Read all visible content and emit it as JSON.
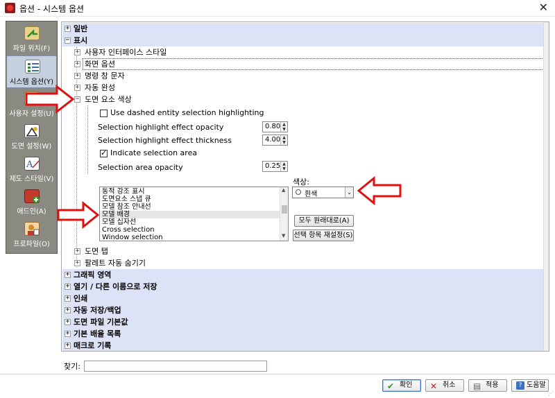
{
  "window": {
    "title": "옵션 - 시스템 옵션",
    "close_icon": "close-icon"
  },
  "sidebar": {
    "items": [
      {
        "label": "파일 위치(F)",
        "icon": "folder-arrow-icon",
        "active": false,
        "color": "#3a8c3a"
      },
      {
        "label": "시스템 옵션(Y)",
        "icon": "checklist-icon",
        "active": true,
        "color": "#3a7bbd"
      },
      {
        "label": "사용자 설정(U)",
        "icon": "pencil-settings-icon",
        "active": false,
        "color": "#c27a1a"
      },
      {
        "label": "도면 설정(W)",
        "icon": "drawing-icon",
        "active": false,
        "color": "#444444"
      },
      {
        "label": "제도 스타일(V)",
        "icon": "text-style-icon",
        "active": false,
        "color": "#2d5aa8"
      },
      {
        "label": "애드인(A)",
        "icon": "addin-icon",
        "active": false,
        "color": "#c0392b"
      },
      {
        "label": "프로파일(O)",
        "icon": "profile-icon",
        "active": false,
        "color": "#d98b2b"
      }
    ]
  },
  "tree": {
    "general": "일반",
    "display": "표시",
    "display_children": [
      "사용자 인터페이스 스타일",
      "화면 옵션",
      "명령 창 문자",
      "자동 완성",
      "도면 요소 색상"
    ],
    "after_children": [
      "도면 탭",
      "팔레트 자동 숨기기"
    ],
    "sections": [
      "그래픽 영역",
      "열기 / 다른 이름으로 저장",
      "인쇄",
      "자동 저장/백업",
      "도면 파일 기본값",
      "기본 배율 목록",
      "매크로 기록"
    ]
  },
  "entity_colors": {
    "dashed_label": "Use dashed entity selection highlighting",
    "dashed_checked": false,
    "opacity_label": "Selection highlight effect opacity",
    "opacity_value": "0.80",
    "thickness_label": "Selection highlight effect thickness",
    "thickness_value": "4.00",
    "indicate_label": "Indicate selection area",
    "indicate_checked": true,
    "area_opacity_label": "Selection area opacity",
    "area_opacity_value": "0.25",
    "list_items": [
      "동적 강조 표시",
      "도면요소 스냅 큐",
      "모델 참조 안내선",
      "모델 배경",
      "모델 십자선",
      "Cross selection",
      "Window selection"
    ],
    "selected_item_index": 3,
    "color_label": "색상:",
    "color_value": "흰색",
    "reset_all_button": "모두 원래대로(A)",
    "reset_selected_button": "선택 항목 재설정(S)"
  },
  "search": {
    "label": "찾기:",
    "value": ""
  },
  "buttons": {
    "ok": "확인",
    "cancel": "취소",
    "apply": "적용",
    "help": "도움말"
  },
  "annotation_color": "#e01010"
}
